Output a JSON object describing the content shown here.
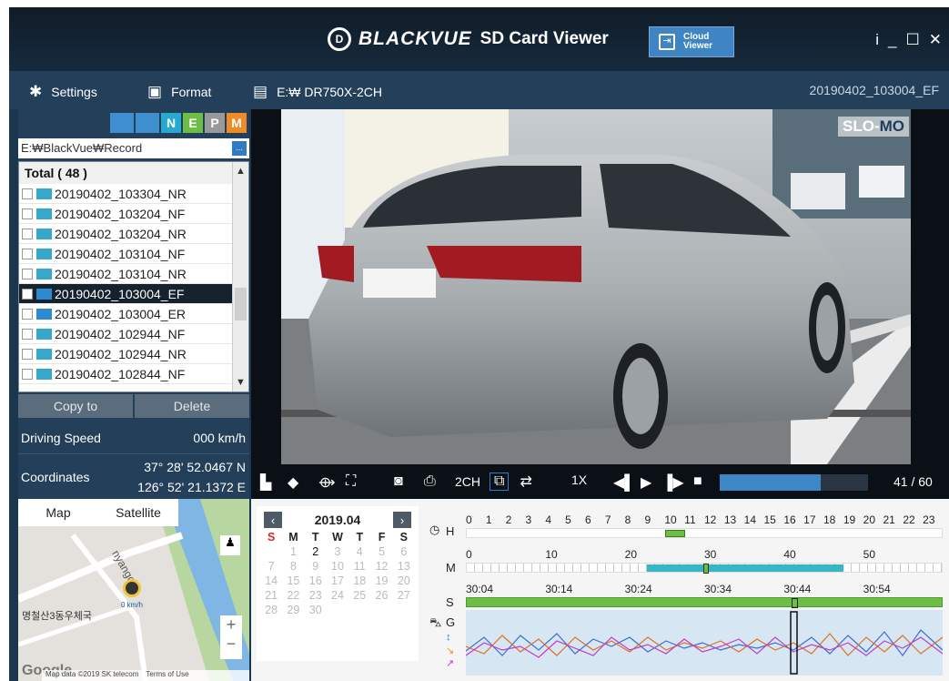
{
  "app": {
    "logo_mark": "D",
    "brand": "BLACKVUE",
    "title": "SD Card Viewer",
    "cloud_button": "Cloud\nViewer",
    "window_controls": [
      "i",
      "_",
      "☐",
      "✕"
    ]
  },
  "toolbar": {
    "settings": "Settings",
    "format": "Format",
    "device": "E:₩ DR750X-2CH",
    "current_file": "20190402_103004_EF"
  },
  "filters": [
    {
      "label": "",
      "color": "#3f8fd0"
    },
    {
      "label": "",
      "color": "#3f8fd0"
    },
    {
      "label": "N",
      "color": "#27a8cf"
    },
    {
      "label": "E",
      "color": "#6dbe45"
    },
    {
      "label": "P",
      "color": "#999999"
    },
    {
      "label": "M",
      "color": "#f08a24"
    }
  ],
  "files": {
    "path": "E:₩BlackVue₩Record",
    "path_button": "...",
    "total_label": "Total ( 48 )",
    "items": [
      {
        "name": "20190402_103304_NR"
      },
      {
        "name": "20190402_103204_NF"
      },
      {
        "name": "20190402_103204_NR"
      },
      {
        "name": "20190402_103104_NF"
      },
      {
        "name": "20190402_103104_NR"
      },
      {
        "name": "20190402_103004_EF",
        "selected": true
      },
      {
        "name": "20190402_103004_ER"
      },
      {
        "name": "20190402_102944_NF"
      },
      {
        "name": "20190402_102944_NR"
      },
      {
        "name": "20190402_102844_NF"
      }
    ],
    "copy_button": "Copy to",
    "delete_button": "Delete"
  },
  "info": {
    "speed_label": "Driving Speed",
    "speed_value": "000 km/h",
    "coords_label": "Coordinates",
    "latitude": "37° 28' 52.0467 N",
    "longitude": "126° 52' 21.1372 E"
  },
  "video": {
    "badge_a": "SLO-",
    "badge_b": "MO",
    "plate": "",
    "channel_label": "2CH",
    "speed": "1X",
    "progress": 0.68,
    "counter": "41 / 60"
  },
  "map": {
    "tab_map": "Map",
    "tab_satellite": "Satellite",
    "road_label": "nyangch",
    "poi": "명철산3동우체국",
    "speed_marker": "0 km/h",
    "zoom_in": "+",
    "zoom_out": "−",
    "attribution": "Map data ©2019 SK telecom",
    "terms": "Terms of Use",
    "logo": "Google"
  },
  "calendar": {
    "month": "2019.04",
    "weekdays": [
      "S",
      "M",
      "T",
      "W",
      "T",
      "F",
      "S"
    ],
    "days": [
      1,
      2,
      3,
      4,
      5,
      6,
      7,
      8,
      9,
      10,
      11,
      12,
      13,
      14,
      15,
      16,
      17,
      18,
      19,
      20,
      21,
      22,
      23,
      24,
      25,
      26,
      27,
      28,
      29,
      30
    ],
    "first_weekday": 1,
    "active_day": 2
  },
  "timeline": {
    "hour_label": "H",
    "minute_label": "M",
    "second_label": "S",
    "gsensor_label": "G",
    "hours": [
      "0",
      "1",
      "2",
      "3",
      "4",
      "5",
      "6",
      "7",
      "8",
      "9",
      "10",
      "11",
      "12",
      "13",
      "14",
      "15",
      "16",
      "17",
      "18",
      "19",
      "20",
      "21",
      "22",
      "23"
    ],
    "minutes": [
      "0",
      "10",
      "20",
      "30",
      "40",
      "50"
    ],
    "seconds": [
      "30:04",
      "30:14",
      "30:24",
      "30:34",
      "30:44",
      "30:54"
    ],
    "active_hour": 10
  }
}
